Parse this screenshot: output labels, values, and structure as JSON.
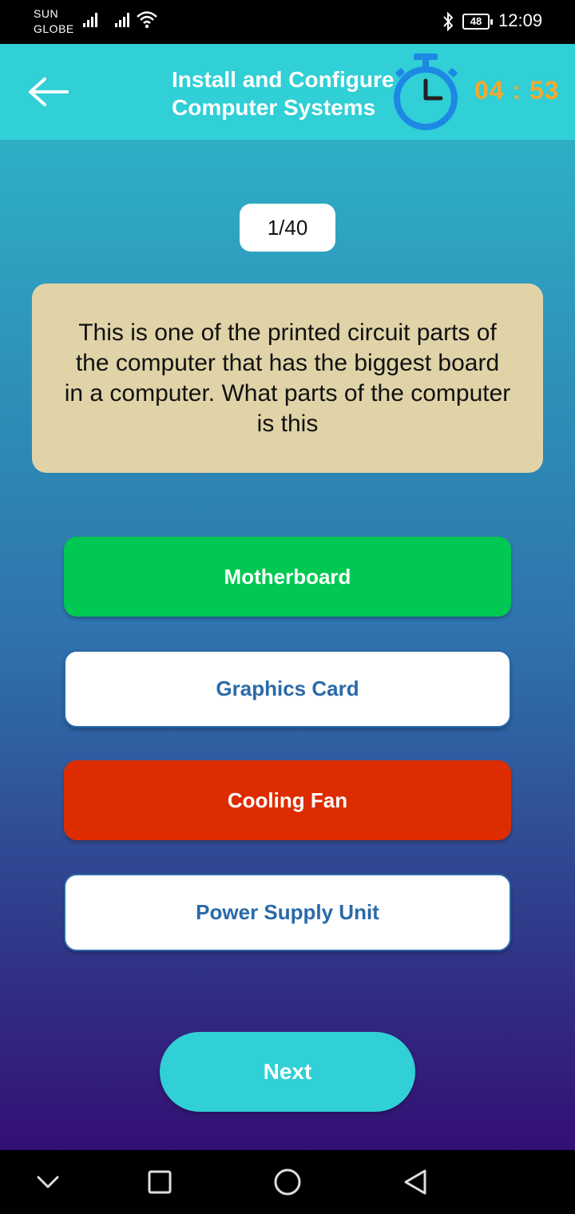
{
  "status_bar": {
    "carrier_line1": "SUN",
    "carrier_line2": "GLOBE",
    "battery": "48",
    "time": "12:09"
  },
  "header": {
    "title": "Install and Configure Computer Systems",
    "timer": "04 : 53",
    "back_icon": "back-arrow-icon",
    "timer_icon": "stopwatch-icon"
  },
  "quiz": {
    "counter": "1/40",
    "question": "This is one of the printed circuit parts of the computer that has the biggest board in a computer. What parts of the computer is this",
    "options": [
      {
        "label": "Motherboard",
        "state": "correct"
      },
      {
        "label": "Graphics Card",
        "state": "neutral"
      },
      {
        "label": "Cooling Fan",
        "state": "wrong"
      },
      {
        "label": "Power Supply Unit",
        "state": "neutral"
      }
    ],
    "next_label": "Next"
  },
  "colors": {
    "header_bg": "#31cfd6",
    "correct": "#00c853",
    "wrong": "#dd2c00",
    "timer_text": "#f2a830",
    "question_bg": "#e0d3a8"
  },
  "nav_bar": {
    "icons": [
      "chevron-down-icon",
      "square-icon",
      "circle-icon",
      "triangle-back-icon"
    ]
  }
}
